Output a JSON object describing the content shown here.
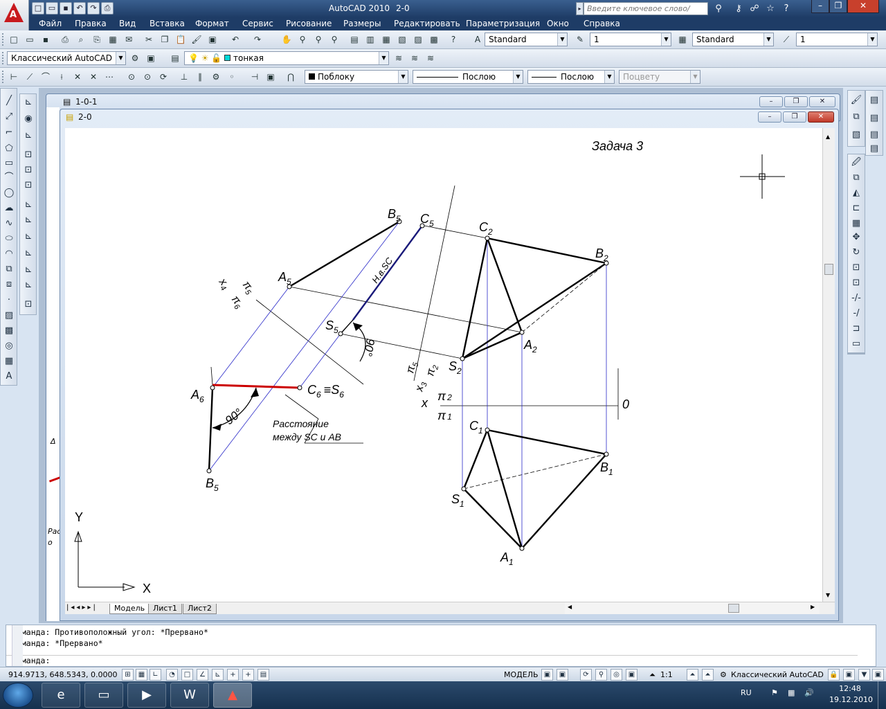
{
  "titlebar": {
    "app_title": "AutoCAD 2010",
    "drawing_name": "2-0",
    "search_placeholder": "Введите ключевое слово/фразу"
  },
  "menu": [
    "Файл",
    "Правка",
    "Вид",
    "Вставка",
    "Формат",
    "Сервис",
    "Рисование",
    "Размеры",
    "Редактировать",
    "Параметризация",
    "Окно",
    "Справка"
  ],
  "toolbar_styles": {
    "text_style": "Standard",
    "dim_scale": "1",
    "table_style": "Standard",
    "ml_scale": "1"
  },
  "toolbar_layers": {
    "workspace": "Классический AutoCAD",
    "layer": "тонкая"
  },
  "toolbar_props": {
    "color": "Поблоку",
    "linetype": "Послою",
    "lineweight": "Послою",
    "plotstyle": "Поцвету"
  },
  "windows": {
    "back_title": "1-0-1",
    "front_title": "2-0"
  },
  "tabs": [
    "Модель",
    "Лист1",
    "Лист2"
  ],
  "drawing": {
    "title": "Задача 3",
    "labels": {
      "B5_top": "B",
      "C5": "C",
      "C2": "C",
      "B2": "B",
      "A5": "A",
      "S5": "S",
      "A2": "A",
      "S2": "S",
      "A6": "A",
      "C6": "C",
      "S6": "S",
      "B5_bot": "B",
      "C1": "C",
      "B1": "B",
      "S1": "S",
      "A1": "A",
      "x4": "x",
      "pi5_a": "π",
      "pi6": "π",
      "x3": "x",
      "pi5_b": "π",
      "pi2_a": "π",
      "x": "x",
      "pi2": "π",
      "pi1": "π",
      "zero": "0",
      "x_axis": "X",
      "y_axis": "Y"
    },
    "subs": {
      "5": "5",
      "2": "2",
      "6": "6",
      "1": "1",
      "4": "4",
      "3": "3"
    },
    "hb_sc": "Н.в.SC",
    "angle_90a": "90°",
    "angle_90b": "90°",
    "equiv": "≡",
    "note_line1": "Расстояние",
    "note_line2": "между SC и AB",
    "left_frag_1": "Δ",
    "left_frag_2": "Рас",
    "left_frag_3": "о"
  },
  "cmdline": {
    "line1": "Команда: Противоположный угол: *Прервано*",
    "line2": "Команда: *Прервано*",
    "prompt": "Команда:"
  },
  "status": {
    "coords": "914.9713, 648.5343, 0.0000",
    "model": "МОДЕЛЬ",
    "scale": "1:1",
    "workspace": "Классический AutoCAD"
  },
  "tray": {
    "lang": "RU",
    "time": "12:48",
    "date": "19.12.2010"
  },
  "colors": {
    "accent_red": "#cc0000",
    "navy_line": "#1a1a7a",
    "thin_blue": "#2828c8"
  }
}
